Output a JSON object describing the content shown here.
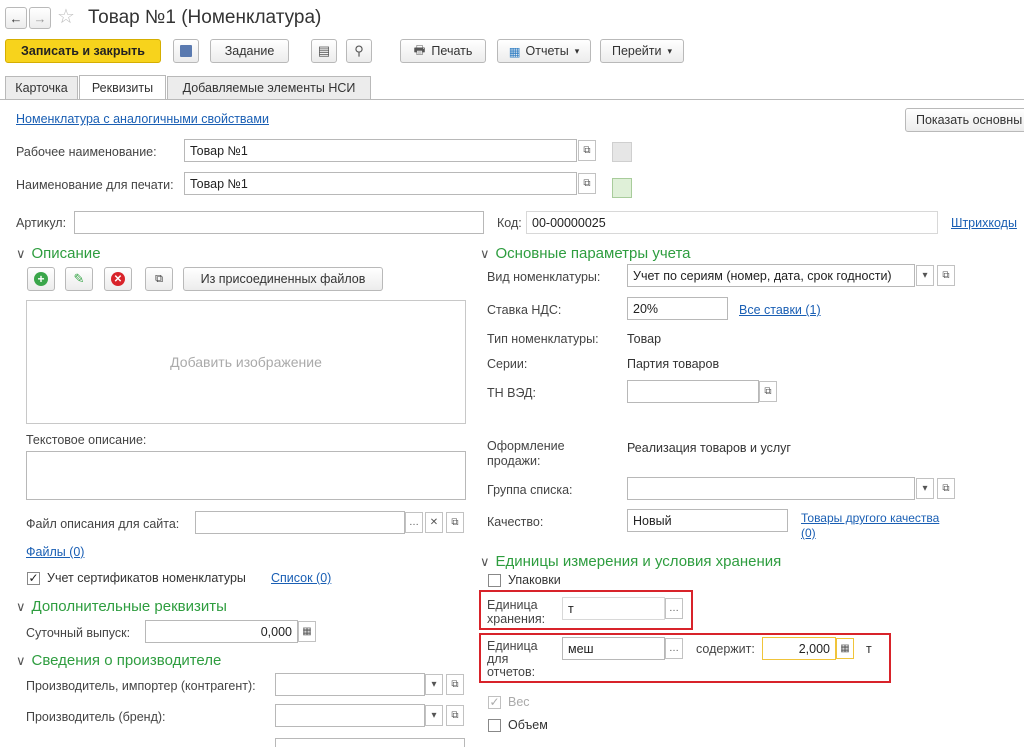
{
  "window": {
    "title": "Товар №1 (Номенклатура)"
  },
  "toolbar": {
    "save_close": "Записать и закрыть",
    "task": "Задание",
    "print": "Печать",
    "reports": "Отчеты",
    "goto": "Перейти"
  },
  "tabs": [
    "Карточка",
    "Реквизиты",
    "Добавляемые элементы НСИ"
  ],
  "top": {
    "similar_link": "Номенклатура с аналогичными свойствами",
    "show_main": "Показать основны",
    "work_name_label": "Рабочее наименование:",
    "work_name_value": "Товар №1",
    "print_name_label": "Наименование для печати:",
    "print_name_value": "Товар №1",
    "article_label": "Артикул:",
    "article_value": "",
    "code_label": "Код:",
    "code_value": "00-00000025",
    "barcodes_link": "Штрихкоды"
  },
  "description": {
    "title": "Описание",
    "from_files_button": "Из присоединенных файлов",
    "add_image": "Добавить изображение",
    "text_label": "Текстовое описание:",
    "site_file_label": "Файл описания для сайта:",
    "files_link": "Файлы (0)",
    "cert_label": "Учет сертификатов номенклатуры",
    "cert_checked": true,
    "list_link": "Список (0)"
  },
  "extra": {
    "title": "Дополнительные реквизиты",
    "daily_output_label": "Суточный выпуск:",
    "daily_output_value": "0,000"
  },
  "manufacturer": {
    "title": "Сведения о производителе",
    "importer_label": "Производитель, импортер (контрагент):",
    "brand_label": "Производитель (бренд):"
  },
  "accounting": {
    "title": "Основные параметры учета",
    "kind_label": "Вид номенклатуры:",
    "kind_value": "Учет по сериям (номер, дата, срок годности)",
    "vat_label": "Ставка НДС:",
    "vat_value": "20%",
    "all_rates_link": "Все ставки (1)",
    "type_label": "Тип номенклатуры:",
    "type_value": "Товар",
    "series_label": "Серии:",
    "series_value": "Партия товаров",
    "tnved_label": "ТН ВЭД:",
    "sale_label_1": "Оформление",
    "sale_label_2": "продажи:",
    "sale_value": "Реализация товаров и услуг",
    "list_group_label": "Группа списка:",
    "quality_label": "Качество:",
    "quality_value": "Новый",
    "other_quality_link_1": "Товары другого качества",
    "other_quality_link_2": "(0)"
  },
  "units": {
    "title": "Единицы измерения и условия хранения",
    "packages_label": "Упаковки",
    "storage_label_1": "Единица",
    "storage_label_2": "хранения:",
    "storage_value": "т",
    "report_label_1": "Единица",
    "report_label_2": "для",
    "report_label_3": "отчетов:",
    "report_value": "меш",
    "contains_label": "содержит:",
    "contains_value": "2,000",
    "contains_unit": "т",
    "weight_label": "Вес",
    "volume_label": "Объем"
  },
  "colors": {
    "accent_green": "#2e9d3f",
    "link_blue": "#1a5fb4",
    "highlight_red": "#d8232a",
    "save_yellow": "#f7d31c"
  }
}
